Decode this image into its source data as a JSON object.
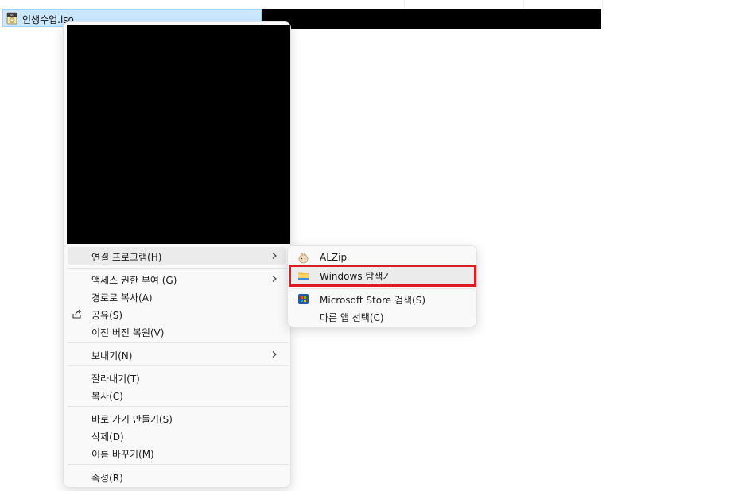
{
  "file": {
    "name": "인생수업.iso",
    "icon": "disc-image-icon"
  },
  "menu": {
    "items": [
      {
        "label": "연결 프로그램(H)",
        "submenu": true
      },
      {
        "label": "액세스 권한 부여 (G)",
        "submenu": true
      },
      {
        "label": "경로로 복사(A)"
      },
      {
        "label": "공유(S)",
        "icon": "share-icon"
      },
      {
        "label": "이전 버전 복원(V)"
      },
      {
        "label": "보내기(N)",
        "submenu": true
      },
      {
        "label": "잘라내기(T)"
      },
      {
        "label": "복사(C)"
      },
      {
        "label": "바로 가기 만들기(S)"
      },
      {
        "label": "삭제(D)"
      },
      {
        "label": "이름 바꾸기(M)"
      },
      {
        "label": "속성(R)"
      }
    ]
  },
  "submenu": {
    "items": [
      {
        "label": "ALZip",
        "icon": "alzip-icon"
      },
      {
        "label": "Windows 탐색기",
        "icon": "folder-icon",
        "highlighted": true
      },
      {
        "label": "Microsoft Store 검색(S)",
        "icon": "store-icon"
      },
      {
        "label": "다른 앱 선택(C)"
      }
    ]
  },
  "colors": {
    "highlight": "#e01b24",
    "selection": "#cce8ff",
    "menu_bg": "#f9f9f9"
  }
}
